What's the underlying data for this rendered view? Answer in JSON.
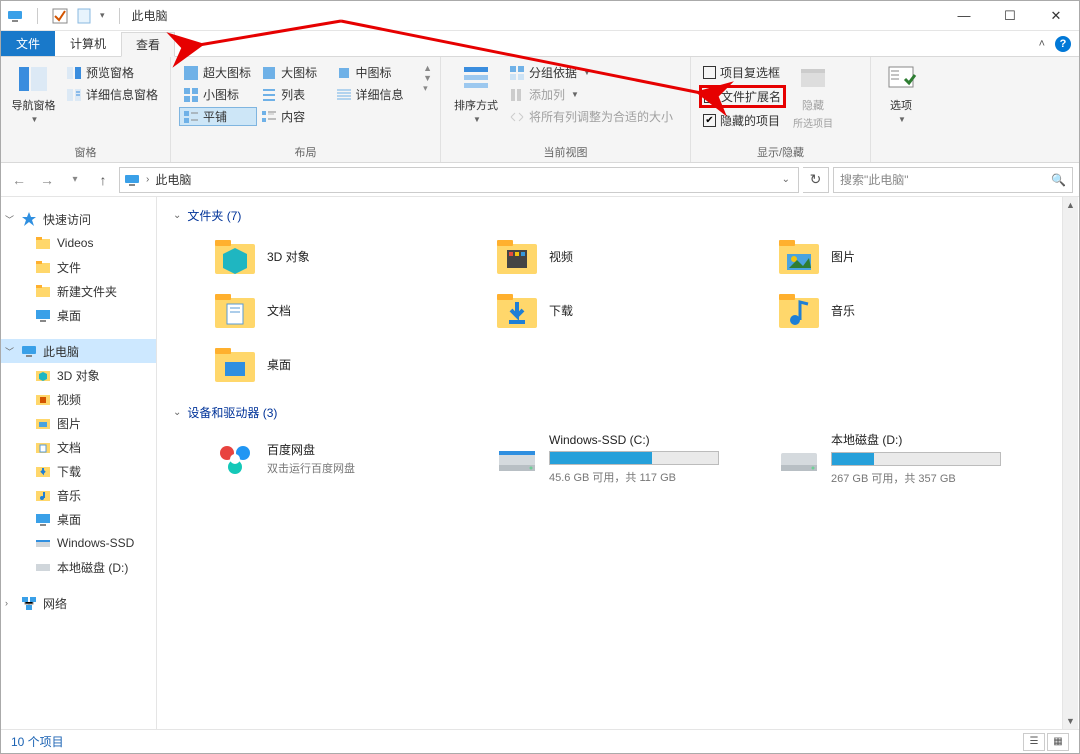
{
  "window": {
    "title": "此电脑",
    "controls": {
      "minimize": "—",
      "maximize": "☐",
      "close": "✕"
    }
  },
  "tabs": {
    "file": "文件",
    "computer": "计算机",
    "view": "查看",
    "help_tip": "?"
  },
  "ribbon": {
    "panes": {
      "nav_pane": "导航窗格",
      "preview_pane": "预览窗格",
      "details_pane": "详细信息窗格",
      "group_label": "窗格"
    },
    "layout": {
      "extra_large_icons": "超大图标",
      "large_icons": "大图标",
      "medium_icons": "中图标",
      "small_icons": "小图标",
      "list": "列表",
      "details": "详细信息",
      "tiles": "平铺",
      "content": "内容",
      "group_label": "布局"
    },
    "current_view": {
      "sort_by": "排序方式",
      "group_by": "分组依据",
      "add_columns": "添加列",
      "fit_columns": "将所有列调整为合适的大小",
      "group_label": "当前视图"
    },
    "show_hide": {
      "item_checkboxes": "项目复选框",
      "file_extensions": "文件扩展名",
      "hidden_items": "隐藏的项目",
      "hide_selected": "隐藏",
      "hide_selected_sub": "所选项目",
      "group_label": "显示/隐藏"
    },
    "options": {
      "label": "选项"
    }
  },
  "addressbar": {
    "location": "此电脑",
    "search_placeholder": "搜索\"此电脑\""
  },
  "sidebar": {
    "quick_access": "快速访问",
    "qa_items": [
      "Videos",
      "文件",
      "新建文件夹",
      "桌面"
    ],
    "this_pc": "此电脑",
    "pc_items": [
      "3D 对象",
      "视频",
      "图片",
      "文档",
      "下载",
      "音乐",
      "桌面",
      "Windows-SSD",
      "本地磁盘 (D:)"
    ],
    "network": "网络"
  },
  "content": {
    "folders_header": "文件夹 (7)",
    "folders": [
      {
        "name": "3D 对象"
      },
      {
        "name": "视频"
      },
      {
        "name": "图片"
      },
      {
        "name": "文档"
      },
      {
        "name": "下载"
      },
      {
        "name": "音乐"
      },
      {
        "name": "桌面"
      }
    ],
    "drives_header": "设备和驱动器 (3)",
    "drives": [
      {
        "name": "百度网盘",
        "sub": "双击运行百度网盘",
        "type": "app"
      },
      {
        "name": "Windows-SSD (C:)",
        "sub": "45.6 GB 可用，共 117 GB",
        "fill_pct": 61
      },
      {
        "name": "本地磁盘 (D:)",
        "sub": "267 GB 可用，共 357 GB",
        "fill_pct": 25
      }
    ]
  },
  "status": {
    "text": "10 个项目"
  }
}
